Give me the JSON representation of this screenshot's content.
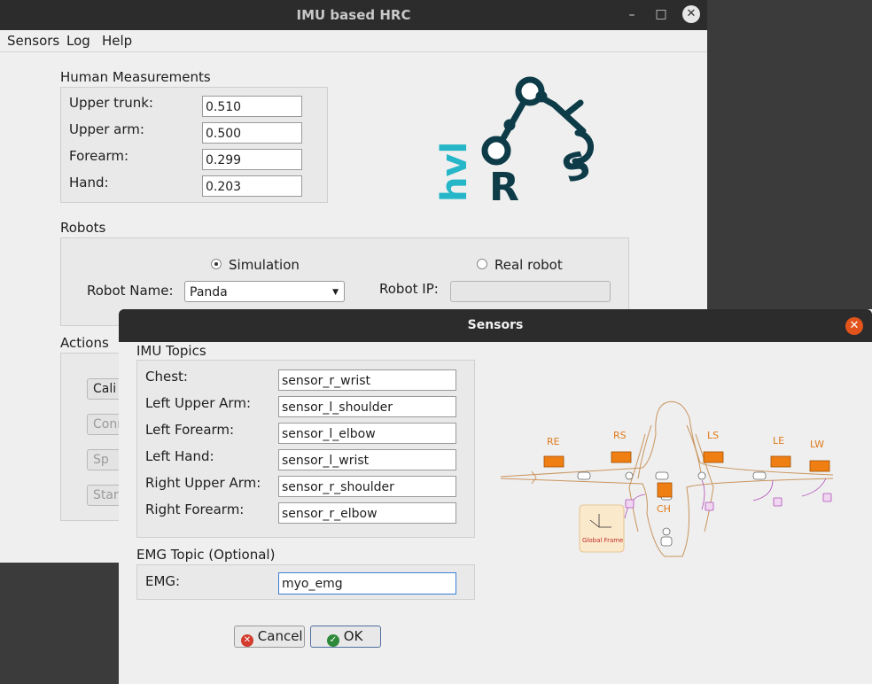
{
  "main_window": {
    "title": "IMU based HRC",
    "controls": {
      "minimize": "–",
      "maximize": "□",
      "close": "✕"
    },
    "menu": [
      "Sensors",
      "Log",
      "Help"
    ],
    "human_measurements": {
      "title": "Human Measurements",
      "rows": [
        {
          "label": "Upper trunk:",
          "value": "0.510"
        },
        {
          "label": "Upper arm:",
          "value": "0.500"
        },
        {
          "label": "Forearm:",
          "value": "0.299"
        },
        {
          "label": "Hand:",
          "value": "0.203"
        }
      ]
    },
    "logo": {
      "hvl": "hvl",
      "r1": "R",
      "r2": "R",
      "s": "S"
    },
    "robots": {
      "title": "Robots",
      "simulation_label": "Simulation",
      "simulation_selected": true,
      "real_robot_label": "Real robot",
      "robot_name_label": "Robot Name:",
      "robot_name_value": "Panda",
      "robot_ip_label": "Robot IP:",
      "robot_ip_value": ""
    },
    "actions": {
      "title": "Actions",
      "buttons": [
        "Cali",
        "Conn",
        "Sp",
        "Star"
      ]
    }
  },
  "sensors_dialog": {
    "title": "Sensors",
    "close": "✕",
    "imu_topics": {
      "title": "IMU Topics",
      "rows": [
        {
          "label": "Chest:",
          "value": "sensor_r_wrist"
        },
        {
          "label": "Left Upper Arm:",
          "value": "sensor_l_shoulder"
        },
        {
          "label": "Left Forearm:",
          "value": "sensor_l_elbow"
        },
        {
          "label": "Left Hand:",
          "value": "sensor_l_wrist"
        },
        {
          "label": "Right Upper Arm:",
          "value": "sensor_r_shoulder"
        },
        {
          "label": "Right Forearm:",
          "value": "sensor_r_elbow"
        }
      ]
    },
    "emg": {
      "title": "EMG Topic (Optional)",
      "label": "EMG:",
      "value": "myo_emg"
    },
    "diagram": {
      "sensors": [
        "RE",
        "RS",
        "LS",
        "LE",
        "LW",
        "CH"
      ],
      "global_frame": "Global Frame",
      "accent": "#f07f13"
    },
    "buttons": {
      "cancel": "Cancel",
      "ok": "OK"
    }
  }
}
